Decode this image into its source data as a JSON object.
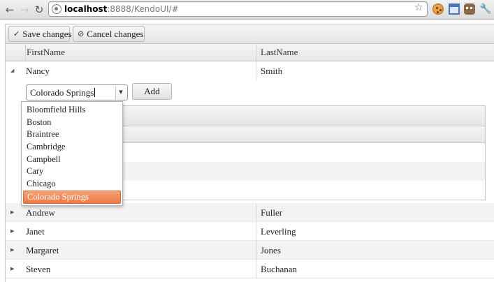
{
  "browser": {
    "url_host": "localhost",
    "url_rest": ":8888/KendoUI/#"
  },
  "toolbar": {
    "save_label": "Save changes",
    "cancel_label": "Cancel changes"
  },
  "grid": {
    "columns": [
      "FirstName",
      "LastName"
    ],
    "expanded_row": {
      "first": "Nancy",
      "last": "Smith"
    },
    "rows": [
      {
        "first": "Andrew",
        "last": "Fuller"
      },
      {
        "first": "Janet",
        "last": "Leverling"
      },
      {
        "first": "Margaret",
        "last": "Jones"
      },
      {
        "first": "Steven",
        "last": "Buchanan"
      }
    ]
  },
  "detail": {
    "combo_value": "Colorado Springs",
    "add_label": "Add",
    "options": [
      "Bloomfield Hills",
      "Boston",
      "Braintree",
      "Cambridge",
      "Campbell",
      "Cary",
      "Chicago",
      "Colorado Springs"
    ],
    "selected_option": "Colorado Springs"
  },
  "icons": {
    "check": "check-icon",
    "cancel": "cancel-icon",
    "collapse": "collapse-triangle-icon",
    "expand": "expand-triangle-icon"
  },
  "colors": {
    "selected_option": "#ef8656"
  }
}
